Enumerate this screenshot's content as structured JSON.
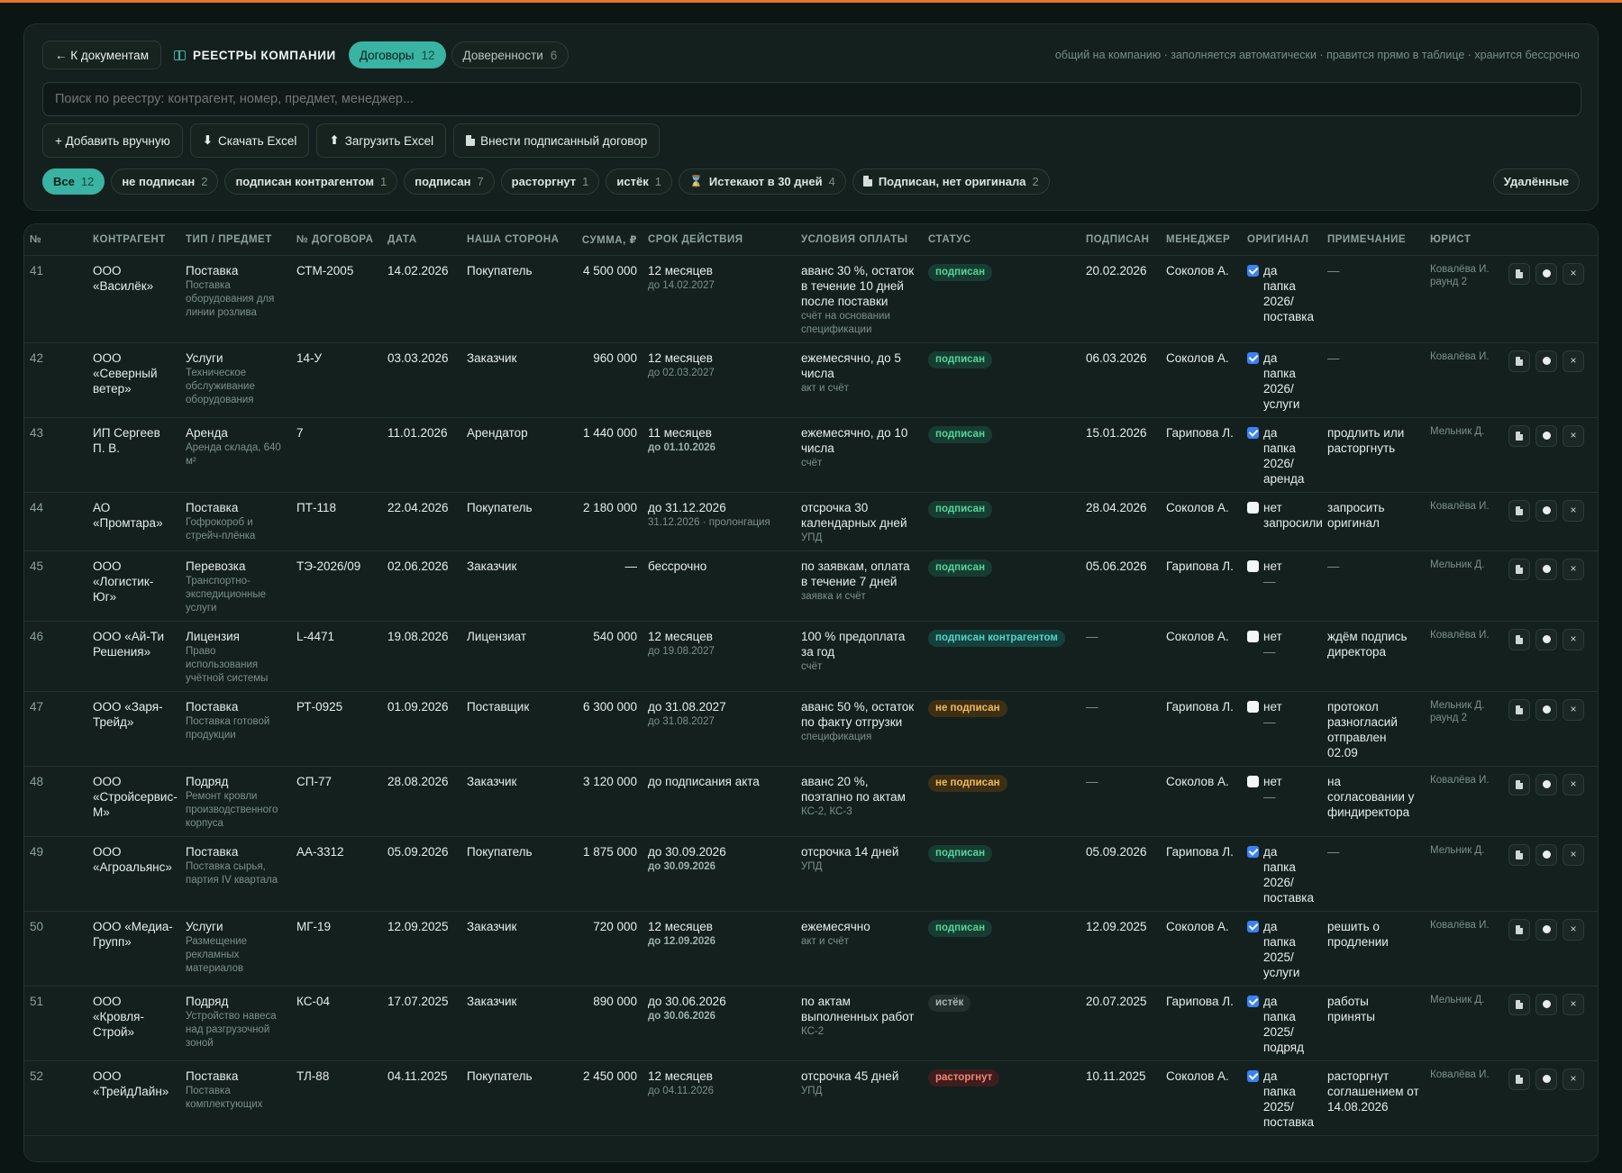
{
  "header": {
    "back_label": "← К документам",
    "title": "РЕЕСТРЫ КОМПАНИИ",
    "tabs": [
      {
        "label": "Договоры",
        "count": "12"
      },
      {
        "label": "Доверенности",
        "count": "6"
      }
    ],
    "hint": "общий на компанию · заполняется автоматически · правится прямо в таблице · хранится бессрочно"
  },
  "search": {
    "placeholder": "Поиск по реестру: контрагент, номер, предмет, менеджер..."
  },
  "actions": {
    "add": "+ Добавить вручную",
    "download": "Скачать Excel",
    "upload": "Загрузить Excel",
    "signed": "Внести подписанный договор"
  },
  "filters": [
    {
      "label": "Все",
      "count": "12"
    },
    {
      "label": "не подписан",
      "count": "2"
    },
    {
      "label": "подписан контрагентом",
      "count": "1"
    },
    {
      "label": "подписан",
      "count": "7"
    },
    {
      "label": "расторгнут",
      "count": "1"
    },
    {
      "label": "истёк",
      "count": "1"
    },
    {
      "label": "Истекают в 30 дней",
      "count": "4"
    },
    {
      "label": "Подписан, нет оригинала",
      "count": "2"
    }
  ],
  "deleted_label": "Удалённые",
  "columns": [
    "№",
    "КОНТРАГЕНТ",
    "ТИП / ПРЕДМЕТ",
    "№ ДОГОВОРА",
    "ДАТА",
    "НАША СТОРОНА",
    "СУММА, ₽",
    "СРОК ДЕЙСТВИЯ",
    "УСЛОВИЯ ОПЛАТЫ",
    "СТАТУС",
    "ПОДПИСАН",
    "МЕНЕДЖЕР",
    "ОРИГИНАЛ",
    "ПРИМЕЧАНИЕ",
    "ЮРИСТ"
  ],
  "rows": [
    {
      "n": "41",
      "cp": "ООО «Василёк»",
      "type": "Поставка",
      "subj": "Поставка оборудования для линии розлива",
      "no": "СТМ-2005",
      "date": "14.02.2026",
      "side": "Покупатель",
      "sum": "4 500 000",
      "term": "12 месяцев",
      "term_sub": "до 14.02.2027",
      "term_strong": false,
      "pay": "аванс 30 %, остаток в течение 10 дней после поставки",
      "pay_sub": "счёт на основании спецификации",
      "status": "подписан",
      "status_kind": "green",
      "signed": "20.02.2026",
      "mgr": "Соколов А.",
      "orig_on": true,
      "orig": "да",
      "orig_sub": "папка 2026/ поставка",
      "note": "—",
      "lawyer": "Ковалёва И.",
      "lawyer2": "раунд 2"
    },
    {
      "n": "42",
      "cp": "ООО «Северный ветер»",
      "type": "Услуги",
      "subj": "Техническое обслуживание оборудования",
      "no": "14-У",
      "date": "03.03.2026",
      "side": "Заказчик",
      "sum": "960 000",
      "term": "12 месяцев",
      "term_sub": "до 02.03.2027",
      "term_strong": false,
      "pay": "ежемесячно, до 5 числа",
      "pay_sub": "акт и счёт",
      "status": "подписан",
      "status_kind": "green",
      "signed": "06.03.2026",
      "mgr": "Соколов А.",
      "orig_on": true,
      "orig": "да",
      "orig_sub": "папка 2026/ услуги",
      "note": "—",
      "lawyer": "Ковалёва И.",
      "lawyer2": ""
    },
    {
      "n": "43",
      "cp": "ИП Сергеев П. В.",
      "type": "Аренда",
      "subj": "Аренда склада, 640 м²",
      "no": "7",
      "date": "11.01.2026",
      "side": "Арендатор",
      "sum": "1 440 000",
      "term": "11 месяцев",
      "term_sub": "до 01.10.2026",
      "term_strong": true,
      "pay": "ежемесячно, до 10 числа",
      "pay_sub": "счёт",
      "status": "подписан",
      "status_kind": "green",
      "signed": "15.01.2026",
      "mgr": "Гарипова Л.",
      "orig_on": true,
      "orig": "да",
      "orig_sub": "папка 2026/ аренда",
      "note": "продлить или расторгнуть",
      "lawyer": "Мельник Д.",
      "lawyer2": ""
    },
    {
      "n": "44",
      "cp": "АО «Промтара»",
      "type": "Поставка",
      "subj": "Гофрокороб и стрейч-плёнка",
      "no": "ПТ-118",
      "date": "22.04.2026",
      "side": "Покупатель",
      "sum": "2 180 000",
      "term": "до 31.12.2026",
      "term_sub": "31.12.2026 · пролонгация",
      "term_strong": false,
      "pay": "отсрочка 30 календарных дней",
      "pay_sub": "УПД",
      "status": "подписан",
      "status_kind": "green",
      "signed": "28.04.2026",
      "mgr": "Соколов А.",
      "orig_on": false,
      "orig": "нет",
      "orig_sub": "запросили",
      "note": "запросить оригинал",
      "lawyer": "Ковалёва И.",
      "lawyer2": ""
    },
    {
      "n": "45",
      "cp": "ООО «Логистик-Юг»",
      "type": "Перевозка",
      "subj": "Транспортно-экспедиционные услуги",
      "no": "ТЭ-2026/09",
      "date": "02.06.2026",
      "side": "Заказчик",
      "sum": "—",
      "term": "бессрочно",
      "term_sub": "",
      "term_strong": false,
      "pay": "по заявкам, оплата в течение 7 дней",
      "pay_sub": "заявка и счёт",
      "status": "подписан",
      "status_kind": "green",
      "signed": "05.06.2026",
      "mgr": "Гарипова Л.",
      "orig_on": false,
      "orig": "нет",
      "orig_sub": "—",
      "note": "—",
      "lawyer": "Мельник Д.",
      "lawyer2": ""
    },
    {
      "n": "46",
      "cp": "ООО «Ай-Ти Решения»",
      "type": "Лицензия",
      "subj": "Право использования учётной системы",
      "no": "L-4471",
      "date": "19.08.2026",
      "side": "Лицензиат",
      "sum": "540 000",
      "term": "12 месяцев",
      "term_sub": "до 19.08.2027",
      "term_strong": false,
      "pay": "100 % предоплата за год",
      "pay_sub": "счёт",
      "status": "подписан контрагентом",
      "status_kind": "teal",
      "signed": "—",
      "mgr": "Соколов А.",
      "orig_on": false,
      "orig": "нет",
      "orig_sub": "—",
      "note": "ждём подпись директора",
      "lawyer": "Ковалёва И.",
      "lawyer2": ""
    },
    {
      "n": "47",
      "cp": "ООО «Заря-Трейд»",
      "type": "Поставка",
      "subj": "Поставка готовой продукции",
      "no": "РТ-0925",
      "date": "01.09.2026",
      "side": "Поставщик",
      "sum": "6 300 000",
      "term": "до 31.08.2027",
      "term_sub": "до 31.08.2027",
      "term_strong": false,
      "pay": "аванс 50 %, остаток по факту отгрузки",
      "pay_sub": "спецификация",
      "status": "не подписан",
      "status_kind": "amber",
      "signed": "—",
      "mgr": "Гарипова Л.",
      "orig_on": false,
      "orig": "нет",
      "orig_sub": "—",
      "note": "протокол разногласий отправлен 02.09",
      "lawyer": "Мельник Д.",
      "lawyer2": "раунд 2"
    },
    {
      "n": "48",
      "cp": "ООО «Стройсервис-М»",
      "type": "Подряд",
      "subj": "Ремонт кровли производственного корпуса",
      "no": "СП-77",
      "date": "28.08.2026",
      "side": "Заказчик",
      "sum": "3 120 000",
      "term": "до подписания акта",
      "term_sub": "",
      "term_strong": false,
      "pay": "аванс 20 %, поэтапно по актам",
      "pay_sub": "КС-2, КС-3",
      "status": "не подписан",
      "status_kind": "amber",
      "signed": "—",
      "mgr": "Соколов А.",
      "orig_on": false,
      "orig": "нет",
      "orig_sub": "—",
      "note": "на согласовании у финдиректора",
      "lawyer": "Ковалёва И.",
      "lawyer2": ""
    },
    {
      "n": "49",
      "cp": "ООО «Агроальянс»",
      "type": "Поставка",
      "subj": "Поставка сырья, партия IV квартала",
      "no": "АА-3312",
      "date": "05.09.2026",
      "side": "Покупатель",
      "sum": "1 875 000",
      "term": "до 30.09.2026",
      "term_sub": "до 30.09.2026",
      "term_strong": true,
      "pay": "отсрочка 14 дней",
      "pay_sub": "УПД",
      "status": "подписан",
      "status_kind": "green",
      "signed": "05.09.2026",
      "mgr": "Гарипова Л.",
      "orig_on": true,
      "orig": "да",
      "orig_sub": "папка 2026/ поставка",
      "note": "—",
      "lawyer": "Мельник Д.",
      "lawyer2": ""
    },
    {
      "n": "50",
      "cp": "ООО «Медиа-Групп»",
      "type": "Услуги",
      "subj": "Размещение рекламных материалов",
      "no": "МГ-19",
      "date": "12.09.2025",
      "side": "Заказчик",
      "sum": "720 000",
      "term": "12 месяцев",
      "term_sub": "до 12.09.2026",
      "term_strong": true,
      "pay": "ежемесячно",
      "pay_sub": "акт и счёт",
      "status": "подписан",
      "status_kind": "green",
      "signed": "12.09.2025",
      "mgr": "Соколов А.",
      "orig_on": true,
      "orig": "да",
      "orig_sub": "папка 2025/ услуги",
      "note": "решить о продлении",
      "lawyer": "Ковалёва И.",
      "lawyer2": ""
    },
    {
      "n": "51",
      "cp": "ООО «Кровля-Строй»",
      "type": "Подряд",
      "subj": "Устройство навеса над разгрузочной зоной",
      "no": "КС-04",
      "date": "17.07.2025",
      "side": "Заказчик",
      "sum": "890 000",
      "term": "до 30.06.2026",
      "term_sub": "до 30.06.2026",
      "term_strong": true,
      "pay": "по актам выполненных работ",
      "pay_sub": "КС-2",
      "status": "истёк",
      "status_kind": "gray",
      "signed": "20.07.2025",
      "mgr": "Гарипова Л.",
      "orig_on": true,
      "orig": "да",
      "orig_sub": "папка 2025/ подряд",
      "note": "работы приняты",
      "lawyer": "Мельник Д.",
      "lawyer2": ""
    },
    {
      "n": "52",
      "cp": "ООО «ТрейдЛайн»",
      "type": "Поставка",
      "subj": "Поставка комплектующих",
      "no": "ТЛ-88",
      "date": "04.11.2025",
      "side": "Покупатель",
      "sum": "2 450 000",
      "term": "12 месяцев",
      "term_sub": "до 04.11.2026",
      "term_strong": false,
      "pay": "отсрочка 45 дней",
      "pay_sub": "УПД",
      "status": "расторгнут",
      "status_kind": "red",
      "signed": "10.11.2025",
      "mgr": "Соколов А.",
      "orig_on": true,
      "orig": "да",
      "orig_sub": "папка 2025/ поставка",
      "note": "расторгнут соглашением от 14.08.2026",
      "lawyer": "Ковалёва И.",
      "lawyer2": ""
    }
  ]
}
